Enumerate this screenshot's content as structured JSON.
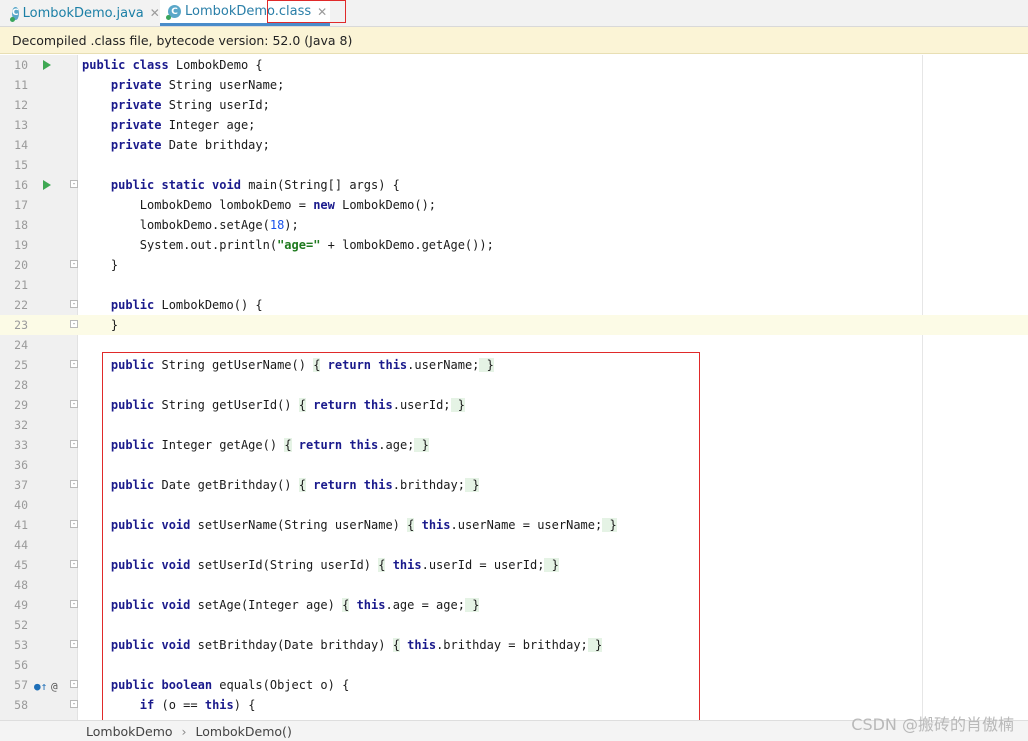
{
  "tabs": [
    {
      "label": "LombokDemo.java",
      "icon": "java-class-icon",
      "active": false
    },
    {
      "label": "LombokDemo.class",
      "icon": "java-class-icon",
      "active": true
    }
  ],
  "banner": "Decompiled .class file, bytecode version: 52.0 (Java 8)",
  "breadcrumb": [
    "LombokDemo",
    "LombokDemo()"
  ],
  "watermark": "CSDN @搬砖的肖傲楠",
  "colors": {
    "keyword": "#1a1a8c",
    "string": "#1f7a1f",
    "number": "#1750eb",
    "highlight_box": "#e02a2a"
  },
  "lines": [
    {
      "n": "10",
      "run": true,
      "html_parts": [
        [
          "kw",
          "public class "
        ],
        [
          "",
          "LombokDemo {"
        ]
      ]
    },
    {
      "n": "11",
      "parts": [
        [
          "",
          "    "
        ],
        [
          "kw",
          "private "
        ],
        [
          "",
          "String userName;"
        ]
      ]
    },
    {
      "n": "12",
      "parts": [
        [
          "",
          "    "
        ],
        [
          "kw",
          "private "
        ],
        [
          "",
          "String userId;"
        ]
      ]
    },
    {
      "n": "13",
      "parts": [
        [
          "",
          "    "
        ],
        [
          "kw",
          "private "
        ],
        [
          "",
          "Integer age;"
        ]
      ]
    },
    {
      "n": "14",
      "parts": [
        [
          "",
          "    "
        ],
        [
          "kw",
          "private "
        ],
        [
          "",
          "Date brithday;"
        ]
      ]
    },
    {
      "n": "15",
      "parts": []
    },
    {
      "n": "16",
      "run": true,
      "fold": true,
      "parts": [
        [
          "",
          "    "
        ],
        [
          "kw",
          "public static void "
        ],
        [
          "",
          "main(String[] args) {"
        ]
      ]
    },
    {
      "n": "17",
      "parts": [
        [
          "",
          "        LombokDemo lombokDemo = "
        ],
        [
          "kw",
          "new "
        ],
        [
          "",
          "LombokDemo();"
        ]
      ]
    },
    {
      "n": "18",
      "parts": [
        [
          "",
          "        lombokDemo.setAge("
        ],
        [
          "num",
          "18"
        ],
        [
          "",
          ");"
        ]
      ]
    },
    {
      "n": "19",
      "parts": [
        [
          "",
          "        System.out.println("
        ],
        [
          "str",
          "\"age=\""
        ],
        [
          "",
          " + lombokDemo.getAge());"
        ]
      ]
    },
    {
      "n": "20",
      "fold": true,
      "parts": [
        [
          "",
          "    }"
        ]
      ]
    },
    {
      "n": "21",
      "parts": []
    },
    {
      "n": "22",
      "fold": true,
      "parts": [
        [
          "",
          "    "
        ],
        [
          "kw",
          "public "
        ],
        [
          "",
          "LombokDemo() {"
        ]
      ]
    },
    {
      "n": "23",
      "fold": true,
      "parts": [
        [
          "",
          "    }"
        ]
      ]
    },
    {
      "n": "24",
      "parts": []
    },
    {
      "n": "25",
      "fold": true,
      "parts": [
        [
          "",
          "    "
        ],
        [
          "kw",
          "public "
        ],
        [
          "",
          "String getUserName() "
        ],
        [
          "brace",
          "{"
        ],
        [
          "",
          " "
        ],
        [
          "kw",
          "return this"
        ],
        [
          "",
          ".userName;"
        ],
        [
          "brace",
          " }"
        ]
      ]
    },
    {
      "n": "28",
      "parts": []
    },
    {
      "n": "29",
      "fold": true,
      "parts": [
        [
          "",
          "    "
        ],
        [
          "kw",
          "public "
        ],
        [
          "",
          "String getUserId() "
        ],
        [
          "brace",
          "{"
        ],
        [
          "",
          " "
        ],
        [
          "kw",
          "return this"
        ],
        [
          "",
          ".userId;"
        ],
        [
          "brace",
          " }"
        ]
      ]
    },
    {
      "n": "32",
      "parts": []
    },
    {
      "n": "33",
      "fold": true,
      "parts": [
        [
          "",
          "    "
        ],
        [
          "kw",
          "public "
        ],
        [
          "",
          "Integer getAge() "
        ],
        [
          "brace",
          "{"
        ],
        [
          "",
          " "
        ],
        [
          "kw",
          "return this"
        ],
        [
          "",
          ".age;"
        ],
        [
          "brace",
          " }"
        ]
      ]
    },
    {
      "n": "36",
      "parts": []
    },
    {
      "n": "37",
      "fold": true,
      "parts": [
        [
          "",
          "    "
        ],
        [
          "kw",
          "public "
        ],
        [
          "",
          "Date getBrithday() "
        ],
        [
          "brace",
          "{"
        ],
        [
          "",
          " "
        ],
        [
          "kw",
          "return this"
        ],
        [
          "",
          ".brithday;"
        ],
        [
          "brace",
          " }"
        ]
      ]
    },
    {
      "n": "40",
      "parts": []
    },
    {
      "n": "41",
      "fold": true,
      "parts": [
        [
          "",
          "    "
        ],
        [
          "kw",
          "public void "
        ],
        [
          "",
          "setUserName(String userName) "
        ],
        [
          "brace",
          "{"
        ],
        [
          "",
          " "
        ],
        [
          "kw",
          "this"
        ],
        [
          "",
          ".userName = userName;"
        ],
        [
          "brace",
          " }"
        ]
      ]
    },
    {
      "n": "44",
      "parts": []
    },
    {
      "n": "45",
      "fold": true,
      "parts": [
        [
          "",
          "    "
        ],
        [
          "kw",
          "public void "
        ],
        [
          "",
          "setUserId(String userId) "
        ],
        [
          "brace",
          "{"
        ],
        [
          "",
          " "
        ],
        [
          "kw",
          "this"
        ],
        [
          "",
          ".userId = userId;"
        ],
        [
          "brace",
          " }"
        ]
      ]
    },
    {
      "n": "48",
      "parts": []
    },
    {
      "n": "49",
      "fold": true,
      "parts": [
        [
          "",
          "    "
        ],
        [
          "kw",
          "public void "
        ],
        [
          "",
          "setAge(Integer age) "
        ],
        [
          "brace",
          "{"
        ],
        [
          "",
          " "
        ],
        [
          "kw",
          "this"
        ],
        [
          "",
          ".age = age;"
        ],
        [
          "brace",
          " }"
        ]
      ]
    },
    {
      "n": "52",
      "parts": []
    },
    {
      "n": "53",
      "fold": true,
      "parts": [
        [
          "",
          "    "
        ],
        [
          "kw",
          "public void "
        ],
        [
          "",
          "setBrithday(Date brithday) "
        ],
        [
          "brace",
          "{"
        ],
        [
          "",
          " "
        ],
        [
          "kw",
          "this"
        ],
        [
          "",
          ".brithday = brithday;"
        ],
        [
          "brace",
          " }"
        ]
      ]
    },
    {
      "n": "56",
      "parts": []
    },
    {
      "n": "57",
      "override": true,
      "fold": true,
      "parts": [
        [
          "",
          "    "
        ],
        [
          "kw",
          "public boolean "
        ],
        [
          "",
          "equals(Object o) {"
        ]
      ]
    },
    {
      "n": "58",
      "fold": true,
      "parts": [
        [
          "",
          "        "
        ],
        [
          "kw",
          "if "
        ],
        [
          "",
          "(o == "
        ],
        [
          "kw",
          "this"
        ],
        [
          "",
          ") {"
        ]
      ]
    }
  ]
}
